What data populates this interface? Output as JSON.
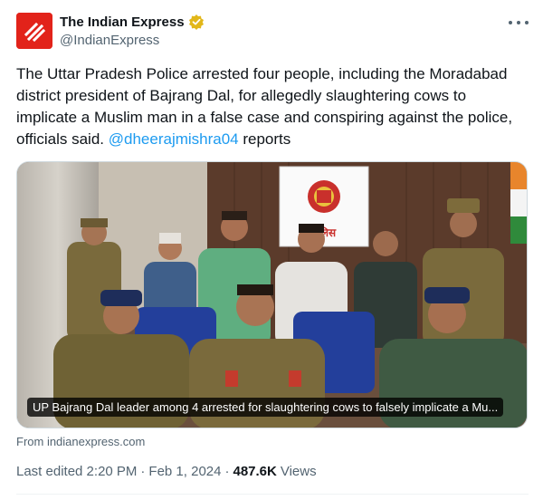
{
  "tweet": {
    "author": {
      "display_name": "The Indian Express",
      "handle": "@IndianExpress",
      "verified_color": "#e2b719",
      "avatar_color": "#e2231a"
    },
    "text_before_mention": "The Uttar Pradesh Police arrested four people, including the Moradabad district president of Bajrang Dal, for allegedly slaughtering cows to implicate a Muslim man in a false case and conspiring against the police, officials said.",
    "mention": "@dheerajmishra04",
    "text_after_mention": " reports",
    "media": {
      "caption": "UP Bajrang Dal leader among 4 arrested for slaughtering cows to falsely implicate a Mu...",
      "poster_text": "पुलिस"
    },
    "source": "From indianexpress.com",
    "meta": {
      "edited": "Last edited 2:20 PM",
      "separator": "·",
      "date": "Feb 1, 2024",
      "views_count": "487.6K",
      "views_label": "Views"
    },
    "colors": {
      "link": "#1d9bf0",
      "secondary_text": "#536471"
    }
  }
}
